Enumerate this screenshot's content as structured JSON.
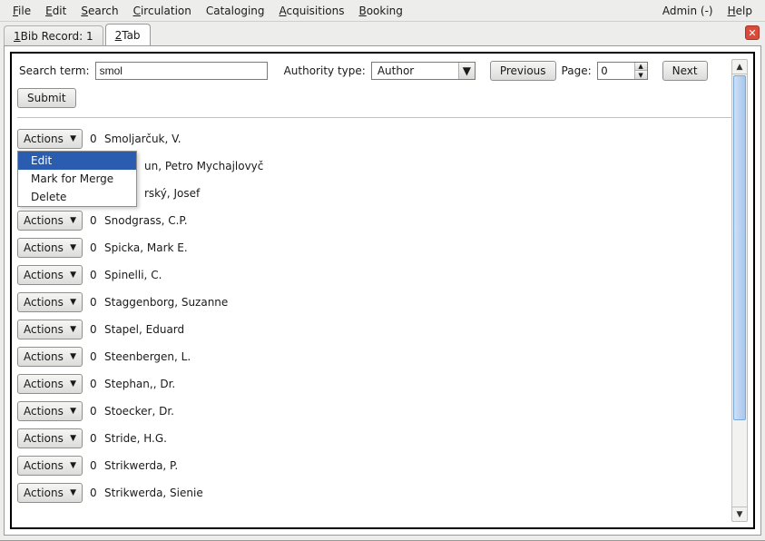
{
  "menu": {
    "file": "File",
    "edit": "Edit",
    "search": "Search",
    "circulation": "Circulation",
    "cataloging": "Cataloging",
    "acquisitions": "Acquisitions",
    "booking": "Booking",
    "admin": "Admin (-)",
    "help": "Help"
  },
  "tabs": {
    "t1_prefix": "1",
    "t1_label": " Bib Record: 1",
    "t2_prefix": "2",
    "t2_label": " Tab",
    "close_glyph": "✕"
  },
  "search": {
    "term_label": "Search term:",
    "term_value": "smol",
    "auth_label": "Authority type:",
    "auth_value": "Author",
    "prev_label": "Previous",
    "page_label": "Page:",
    "page_value": "0",
    "next_label": "Next",
    "submit_label": "Submit"
  },
  "actions": {
    "btn_label": "Actions",
    "menu": {
      "edit": "Edit",
      "mark": "Mark for Merge",
      "delete": "Delete"
    }
  },
  "results": [
    {
      "count": "0",
      "name": "Smoljarčuk, V."
    },
    {
      "count": "",
      "name": "un, Petro Mychajlovyč"
    },
    {
      "count": "",
      "name": "rský, Josef"
    },
    {
      "count": "0",
      "name": "Snodgrass, C.P."
    },
    {
      "count": "0",
      "name": "Spicka, Mark E."
    },
    {
      "count": "0",
      "name": "Spinelli, C."
    },
    {
      "count": "0",
      "name": "Staggenborg, Suzanne"
    },
    {
      "count": "0",
      "name": "Stapel, Eduard"
    },
    {
      "count": "0",
      "name": "Steenbergen, L."
    },
    {
      "count": "0",
      "name": "Stephan,, Dr."
    },
    {
      "count": "0",
      "name": "Stoecker, Dr."
    },
    {
      "count": "0",
      "name": "Stride, H.G."
    },
    {
      "count": "0",
      "name": "Strikwerda, P."
    },
    {
      "count": "0",
      "name": "Strikwerda, Sienie"
    }
  ]
}
